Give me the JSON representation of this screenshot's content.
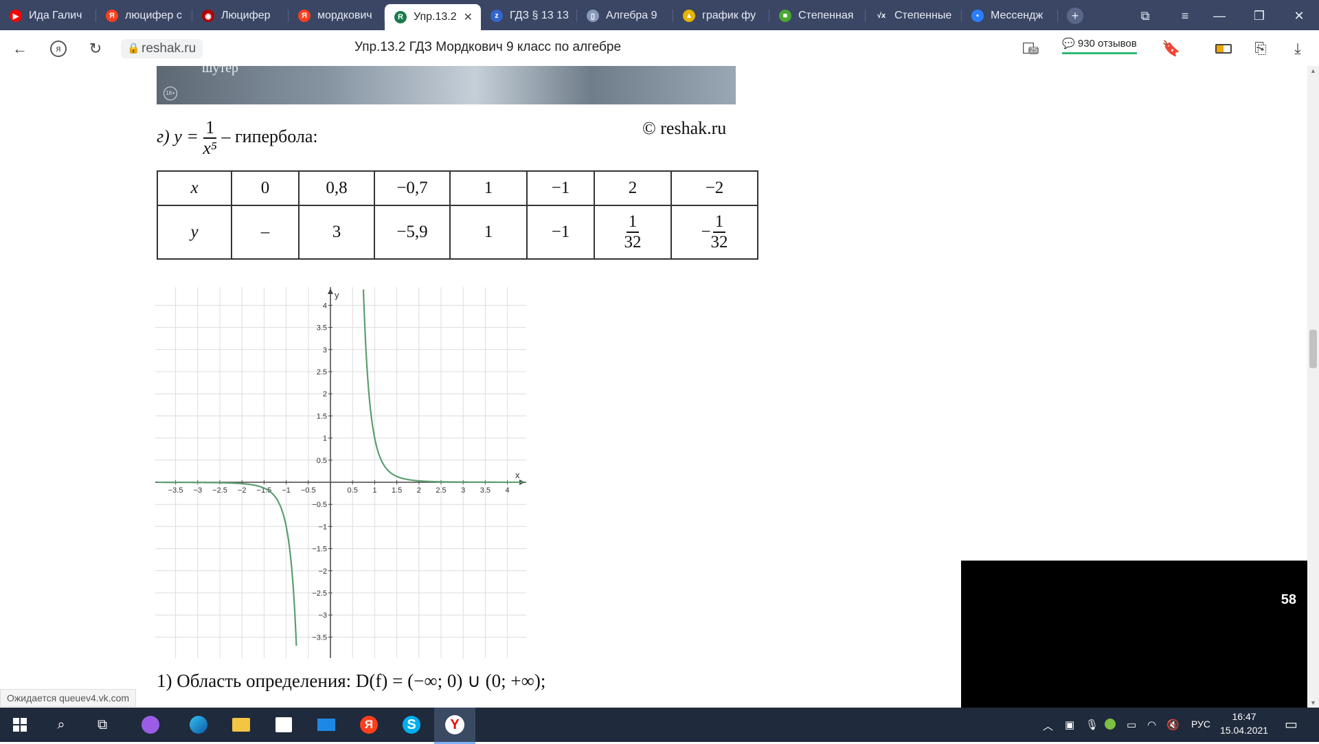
{
  "tabs": [
    {
      "title": "Ида Галич",
      "icon": "youtube-icon",
      "color": "#ff0000",
      "glyph": "▶"
    },
    {
      "title": "люцифер с",
      "icon": "yandex-icon",
      "color": "#fc3f1d",
      "glyph": "Я"
    },
    {
      "title": "Люцифер",
      "icon": "devil-icon",
      "color": "#b30000",
      "glyph": "◉"
    },
    {
      "title": "мордкович",
      "icon": "yandex-icon",
      "color": "#fc3f1d",
      "glyph": "Я"
    },
    {
      "title": "Упр.13.2",
      "icon": "reshak-icon",
      "color": "#1a7a4c",
      "glyph": "R",
      "active": true
    },
    {
      "title": "ГДЗ § 13 13",
      "icon": "gdz-icon",
      "color": "#3366cc",
      "glyph": "z"
    },
    {
      "title": "Алгебра 9",
      "icon": "document-icon",
      "color": "#8899bb",
      "glyph": "▯"
    },
    {
      "title": "график фу",
      "icon": "image-icon",
      "color": "#e8b400",
      "glyph": "▲"
    },
    {
      "title": "Степенная",
      "icon": "sheet-icon",
      "color": "#4aa832",
      "glyph": "■"
    },
    {
      "title": "Степенные",
      "icon": "sqrt-icon",
      "color": "#3a4664",
      "glyph": "√x"
    },
    {
      "title": "Мессендж",
      "icon": "messenger-icon",
      "color": "#2a7fff",
      "glyph": "▪"
    }
  ],
  "address": {
    "domain": "reshak.ru",
    "page_title": "Упр.13.2 ГДЗ Мордкович 9 класс по алгебре",
    "reviews": "930 отзывов",
    "badge_count": "25"
  },
  "content": {
    "ad_caption": "шутер",
    "ad_age": "18+",
    "caption_prefix": "г) y =",
    "frac_num": "1",
    "frac_den": "x⁵",
    "caption_suffix": "– гипербола:",
    "copyright": "© reshak.ru",
    "table": {
      "row1": [
        "x",
        "0",
        "0,8",
        "−0,7",
        "1",
        "−1",
        "2",
        "−2"
      ],
      "row2": [
        "y",
        "–",
        "3",
        "−5,9",
        "1",
        "−1",
        "1/32",
        "−1/32"
      ]
    },
    "domain_text": "1) Область определения:  D(f) = (−∞; 0) ∪ (0; +∞);"
  },
  "chart_data": {
    "type": "line",
    "title": "",
    "xlabel": "x",
    "ylabel": "y",
    "xlim": [
      -4,
      4.5
    ],
    "ylim": [
      -4,
      4.5
    ],
    "grid": true,
    "xticks": [
      -3.5,
      -3,
      -2.5,
      -2,
      -1.5,
      -1,
      -0.5,
      0.5,
      1,
      1.5,
      2,
      2.5,
      3,
      3.5,
      4
    ],
    "yticks": [
      -3.5,
      -3,
      -2.5,
      -2,
      -1.5,
      -1,
      -0.5,
      0.5,
      1,
      1.5,
      2,
      2.5,
      3,
      3.5,
      4
    ],
    "series": [
      {
        "function": "1/x^5",
        "color": "#5a9e6f"
      }
    ]
  },
  "status": "Ожидается queuev4.vk.com",
  "video_number": "58",
  "taskbar": {
    "lang": "РУС",
    "time": "16:47",
    "date": "15.04.2021"
  }
}
